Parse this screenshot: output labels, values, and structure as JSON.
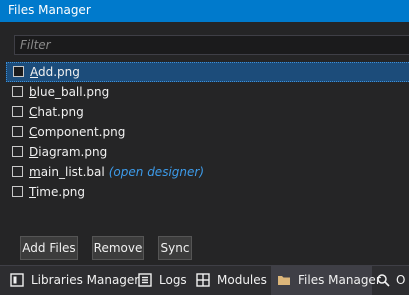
{
  "window": {
    "title": "Files Manager"
  },
  "filter": {
    "placeholder": "Filter"
  },
  "files": [
    {
      "first": "A",
      "rest": "dd.png",
      "hint": "",
      "checked": false,
      "selected": true
    },
    {
      "first": "b",
      "rest": "lue_ball.png",
      "hint": "",
      "checked": false,
      "selected": false
    },
    {
      "first": "C",
      "rest": "hat.png",
      "hint": "",
      "checked": false,
      "selected": false
    },
    {
      "first": "C",
      "rest": "omponent.png",
      "hint": "",
      "checked": false,
      "selected": false
    },
    {
      "first": "D",
      "rest": "iagram.png",
      "hint": "",
      "checked": false,
      "selected": false
    },
    {
      "first": "m",
      "rest": "ain_list.bal",
      "hint": "(open designer)",
      "checked": false,
      "selected": false
    },
    {
      "first": "T",
      "rest": "ime.png",
      "hint": "",
      "checked": false,
      "selected": false
    }
  ],
  "buttons": {
    "add": "Add Files",
    "remove": "Remove",
    "sync": "Sync"
  },
  "tabs": [
    {
      "label": "Libraries Manager",
      "icon": "libraries-icon",
      "active": false
    },
    {
      "label": "Logs",
      "icon": "logs-icon",
      "active": false
    },
    {
      "label": "Modules",
      "icon": "modules-icon",
      "active": false
    },
    {
      "label": "Files Manager",
      "icon": "folder-icon",
      "active": true
    },
    {
      "label": "O",
      "icon": "search-icon",
      "active": false
    }
  ],
  "colors": {
    "accent": "#007acc",
    "selection": "#1c4c7a",
    "hint": "#3d9be9",
    "folder": "#dcb67a"
  }
}
